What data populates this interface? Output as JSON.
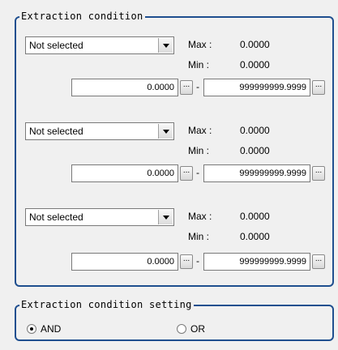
{
  "extraction_group": {
    "title": "Extraction condition",
    "conditions": [
      {
        "selector": "Not selected",
        "max_label": "Max :",
        "max_value": "0.0000",
        "min_label": "Min :",
        "min_value": "0.0000",
        "lower": "0.0000",
        "upper": "999999999.9999",
        "dots": "...",
        "dash": "-"
      },
      {
        "selector": "Not selected",
        "max_label": "Max :",
        "max_value": "0.0000",
        "min_label": "Min :",
        "min_value": "0.0000",
        "lower": "0.0000",
        "upper": "999999999.9999",
        "dots": "...",
        "dash": "-"
      },
      {
        "selector": "Not selected",
        "max_label": "Max :",
        "max_value": "0.0000",
        "min_label": "Min :",
        "min_value": "0.0000",
        "lower": "0.0000",
        "upper": "999999999.9999",
        "dots": "...",
        "dash": "-"
      }
    ]
  },
  "setting_group": {
    "title": "Extraction condition setting",
    "options": [
      {
        "label": "AND",
        "selected": true
      },
      {
        "label": "OR",
        "selected": false
      }
    ]
  }
}
